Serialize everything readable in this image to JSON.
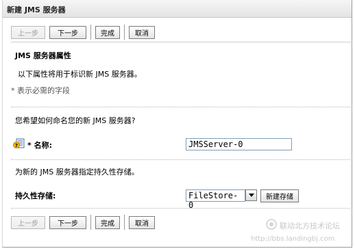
{
  "window": {
    "title": "新建 JMS 服务器"
  },
  "nav": {
    "back_label": "上一步",
    "next_label": "下一步",
    "finish_label": "完成",
    "cancel_label": "取消"
  },
  "section": {
    "heading": "JMS 服务器属性",
    "description": "以下属性将用于标识新 JMS 服务器。",
    "required_note": "* 表示必需的字段"
  },
  "name_block": {
    "question": "您希望如何命名您的新 JMS 服务器?",
    "label": "* 名称:",
    "value": "JMSServer-0"
  },
  "store_block": {
    "prompt": "为新的 JMS 服务器指定持久性存储。",
    "label": "持久性存储:",
    "selected": "FileStore-0",
    "new_store_label": "新建存储"
  },
  "watermark": {
    "line1": "联动北方技术论坛",
    "line2": "http://bbs.landingbj.com"
  }
}
